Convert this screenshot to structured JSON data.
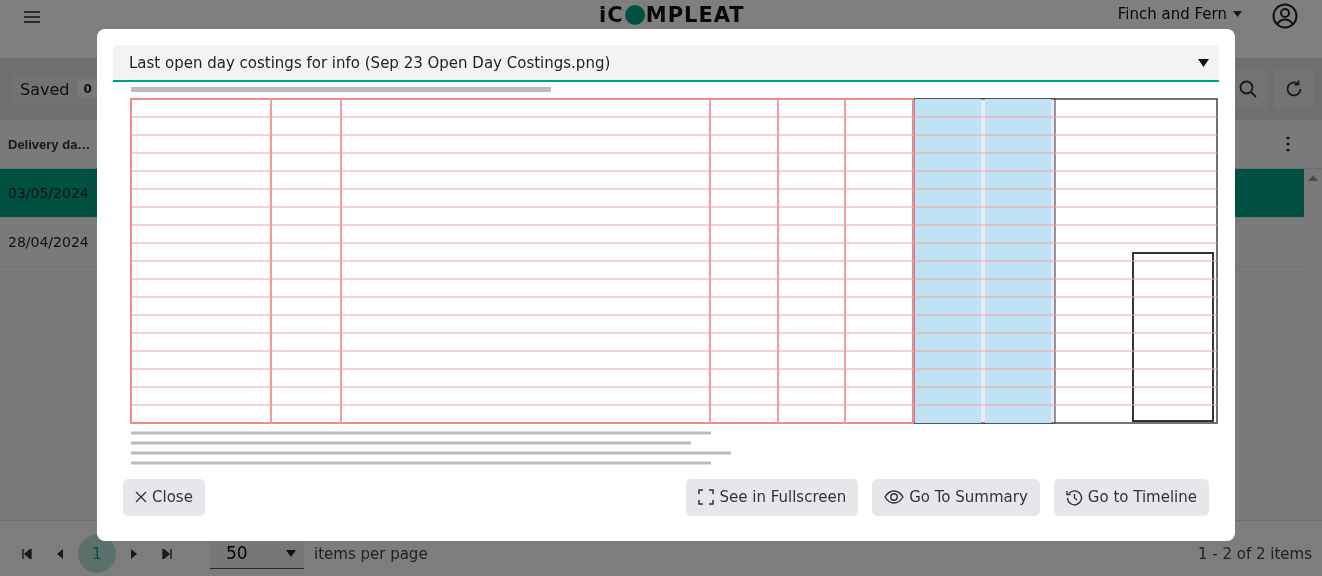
{
  "header": {
    "logo": {
      "left": "iC",
      "right": "MPLEAT"
    },
    "account": "Finch and Fern"
  },
  "toolbar": {
    "saved_label": "Saved",
    "saved_count": "0"
  },
  "table": {
    "columns": [
      "Delivery da…"
    ],
    "rows": [
      {
        "cells": [
          "03/05/2024"
        ],
        "selected": true
      },
      {
        "cells": [
          "28/04/2024"
        ],
        "selected": false
      }
    ]
  },
  "pagination": {
    "pages": [
      {
        "label": "1",
        "selected": true
      }
    ],
    "page_size": "50",
    "page_size_label": "items per page",
    "summary": "1 - 2 of 2 items"
  },
  "dialog": {
    "attachment": "Last open day costings for info (Sep 23 Open Day Costings.png)",
    "buttons": [
      {
        "label": "Close",
        "kind": "close"
      },
      {
        "label": "See in Fullscreen",
        "kind": "fullscreen"
      },
      {
        "label": "Go To Summary",
        "kind": "summary"
      },
      {
        "label": "Go to Timeline",
        "kind": "timeline"
      }
    ]
  }
}
